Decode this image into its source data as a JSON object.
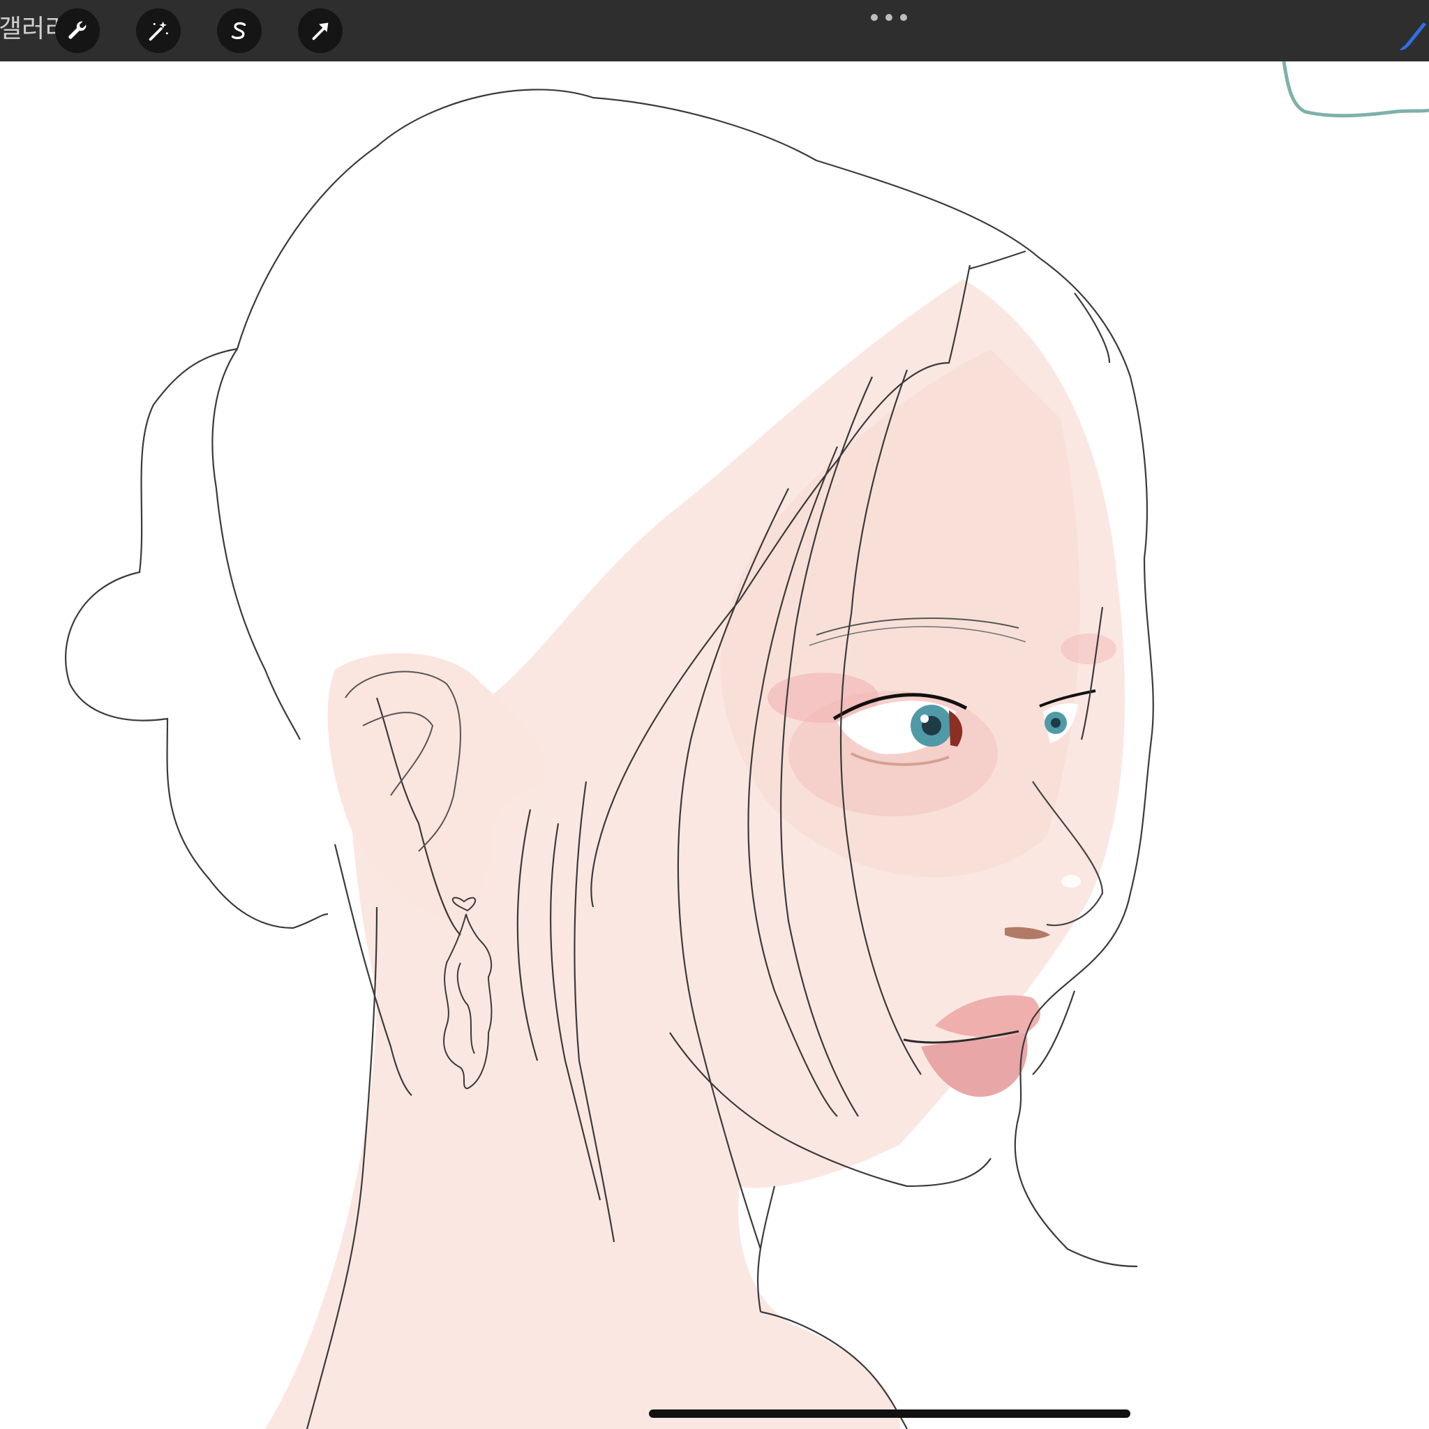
{
  "toolbar": {
    "gallery_label": "갤러리",
    "buttons": [
      {
        "name": "actions",
        "icon": "wrench-icon"
      },
      {
        "name": "adjustments",
        "icon": "magic-wand-icon"
      },
      {
        "name": "selection",
        "icon": "selection-s-icon"
      },
      {
        "name": "transform",
        "icon": "arrow-cursor-icon"
      }
    ],
    "more_icon": "ellipsis-icon",
    "brush_icon": "brush-icon"
  },
  "colors": {
    "toolbar_bg": "#2e2e2e",
    "button_bg": "#151515",
    "brush_accent": "#2f6fe8",
    "skin": "#fbe7e2",
    "cheek": "#f3c2c0",
    "lips": "#efb0ad",
    "iris": "#4f9aa6",
    "line": "#2b2b2b",
    "teal_stroke": "#7fb0aa"
  }
}
